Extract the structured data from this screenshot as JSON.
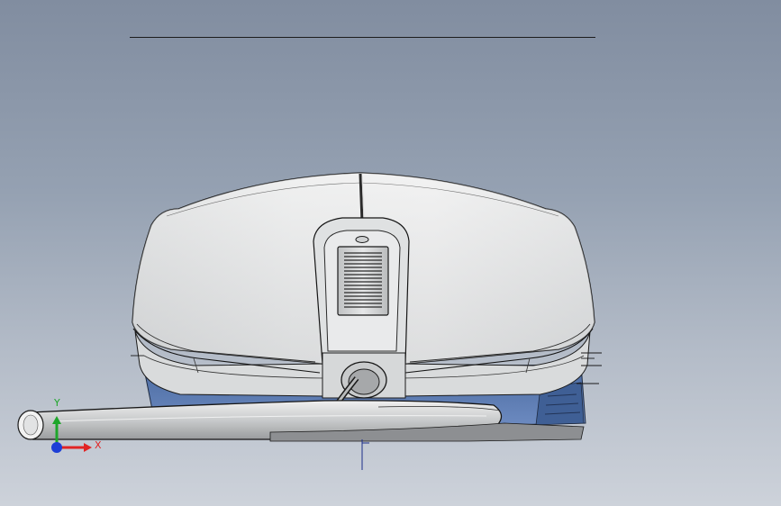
{
  "viewport": {
    "background_top": "#818da0",
    "background_bottom": "#cdd2da",
    "model_body_color": "#e8e9e9",
    "model_base_color": "#5676a9"
  },
  "triad": {
    "x_label": "X",
    "y_label": "Y",
    "x_color": "#e12424",
    "y_color": "#1ea62a",
    "z_color": "#1d3ed6"
  }
}
